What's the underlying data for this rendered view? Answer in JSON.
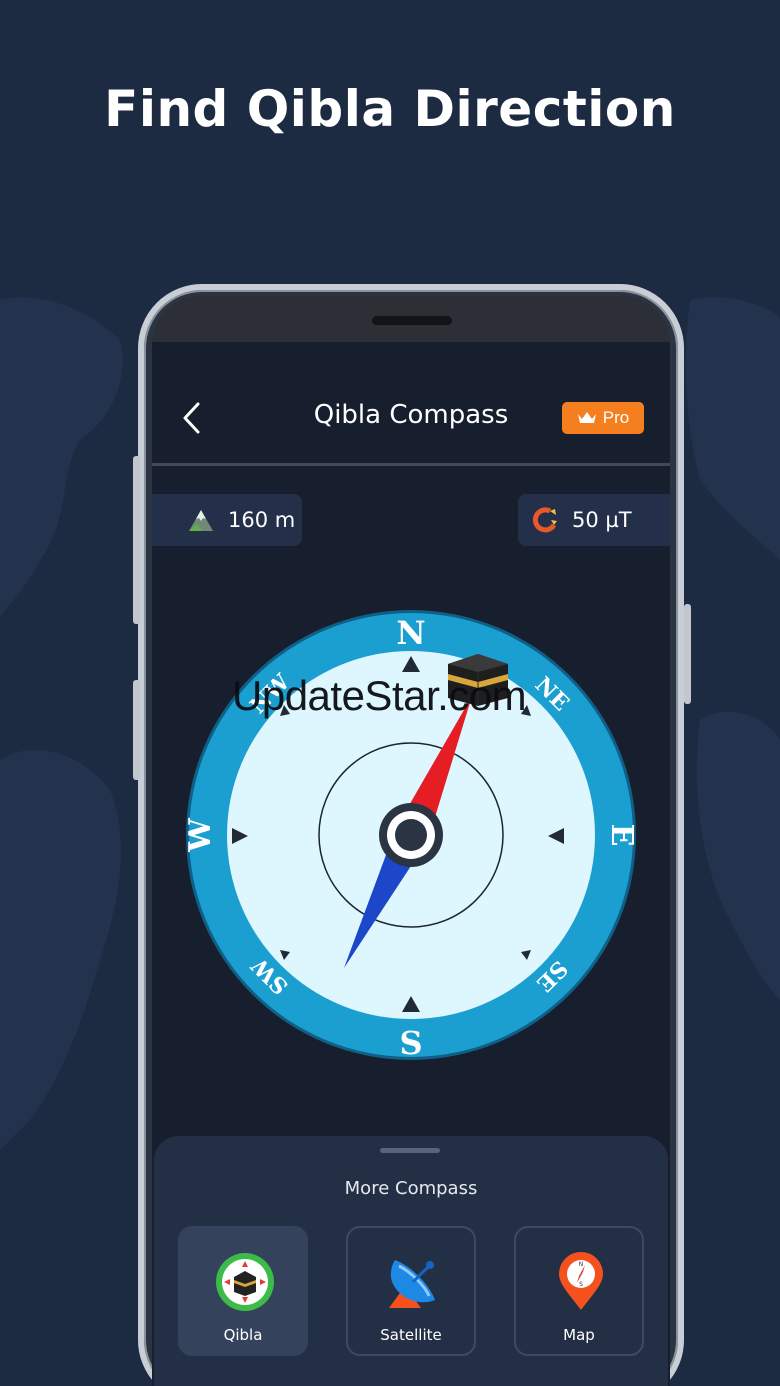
{
  "headline": "Find Qibla Direction",
  "app": {
    "title": "Qibla Compass",
    "pro_label": "Pro",
    "altitude": "160 m",
    "magnetic_field": "50 µT"
  },
  "compass": {
    "directions": {
      "n": "N",
      "ne": "NE",
      "e": "E",
      "se": "SE",
      "s": "S",
      "sw": "SW",
      "w": "W",
      "nw": "NW"
    }
  },
  "watermark": "UpdateStar.com",
  "more_compass": {
    "title": "More Compass",
    "items": [
      {
        "label": "Qibla",
        "active": true
      },
      {
        "label": "Satellite",
        "active": false
      },
      {
        "label": "Map",
        "active": false
      }
    ]
  },
  "colors": {
    "background": "#1d2b42",
    "screen": "#171e2d",
    "compass_ring": "#1a9fd0",
    "compass_face": "#def6fd",
    "needle_north": "#e51d25",
    "needle_south": "#1c47c9",
    "pro_badge": "#f57e1f"
  }
}
